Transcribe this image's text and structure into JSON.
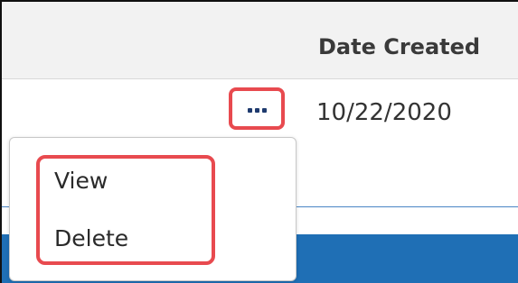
{
  "table": {
    "header": {
      "date_created_label": "Date Created"
    },
    "row": {
      "date_created": "10/22/2020"
    },
    "actions_icon": "ellipsis-icon"
  },
  "menu": {
    "items": [
      {
        "label": "View"
      },
      {
        "label": "Delete"
      }
    ]
  },
  "colors": {
    "highlight": "#e84a4f",
    "accent_blue": "#1f6fb5",
    "dots": "#1e3a6e"
  }
}
